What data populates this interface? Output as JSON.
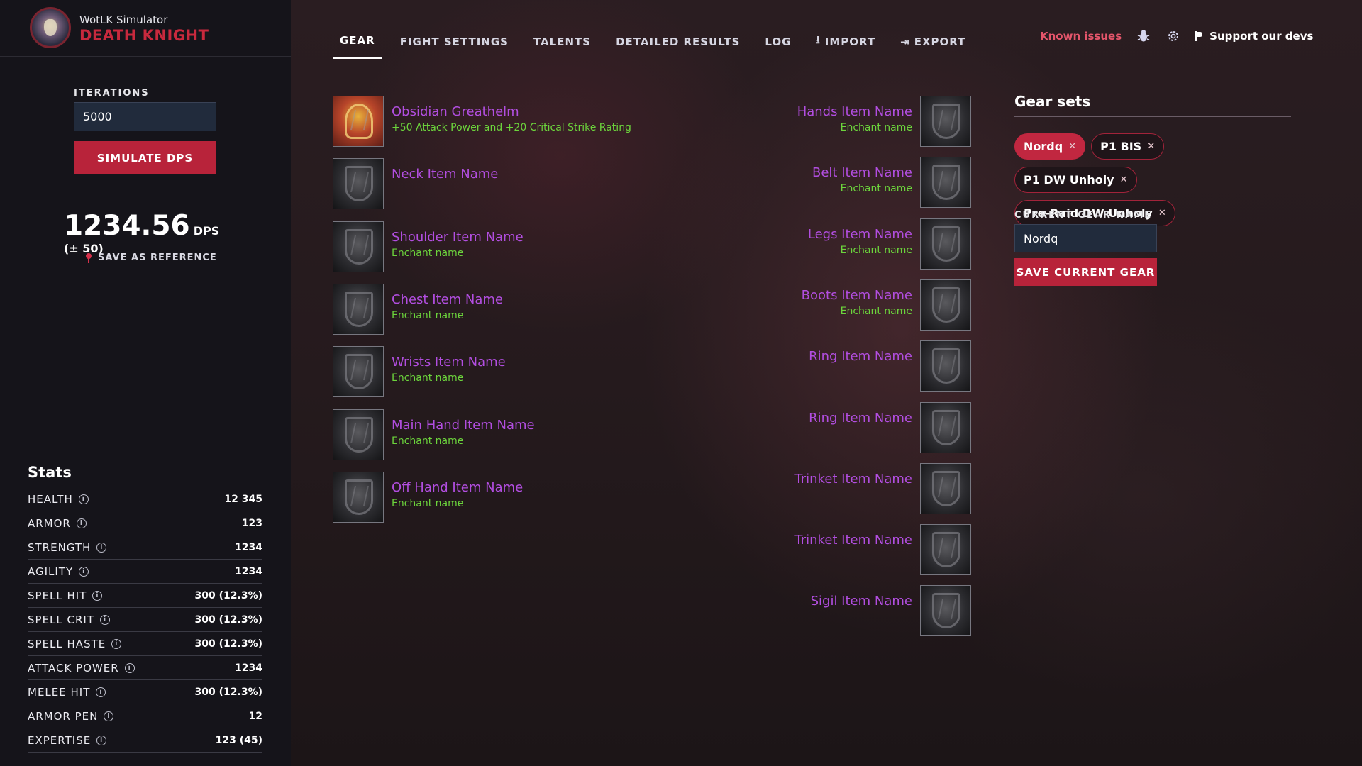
{
  "brand": {
    "subtitle": "WotLK Simulator",
    "title": "DEATH KNIGHT"
  },
  "sidebar": {
    "iterations_label": "ITERATIONS",
    "iterations_value": "5000",
    "simulate_label": "SIMULATE DPS",
    "dps_value": "1234.56",
    "dps_unit": "DPS (± 50)",
    "save_reference_label": "SAVE AS REFERENCE"
  },
  "stats": {
    "title": "Stats",
    "rows": [
      {
        "name": "HEALTH",
        "value": "12 345"
      },
      {
        "name": "ARMOR",
        "value": "123"
      },
      {
        "name": "STRENGTH",
        "value": "1234"
      },
      {
        "name": "AGILITY",
        "value": "1234"
      },
      {
        "name": "SPELL HIT",
        "value": "300 (12.3%)"
      },
      {
        "name": "SPELL CRIT",
        "value": "300 (12.3%)"
      },
      {
        "name": "SPELL HASTE",
        "value": "300 (12.3%)"
      },
      {
        "name": "ATTACK POWER",
        "value": "1234"
      },
      {
        "name": "MELEE HIT",
        "value": "300 (12.3%)"
      },
      {
        "name": "ARMOR PEN",
        "value": "12"
      },
      {
        "name": "EXPERTISE",
        "value": "123 (45)"
      }
    ]
  },
  "nav": {
    "tabs": [
      "GEAR",
      "FIGHT SETTINGS",
      "TALENTS",
      "DETAILED RESULTS",
      "LOG",
      "IMPORT",
      "EXPORT"
    ],
    "active_tab": "GEAR",
    "known_issues": "Known issues",
    "support": "Support our devs"
  },
  "gear": {
    "left": [
      {
        "name": "Obsidian Greathelm",
        "enchant": "+50 Attack Power and +20 Critical Strike Rating",
        "icon": "helm-icon"
      },
      {
        "name": "Neck Item Name",
        "enchant": "",
        "icon": "empty-slot-icon"
      },
      {
        "name": "Shoulder Item Name",
        "enchant": "Enchant name",
        "icon": "empty-slot-icon"
      },
      {
        "name": "Chest Item Name",
        "enchant": "Enchant name",
        "icon": "empty-slot-icon"
      },
      {
        "name": "Wrists Item Name",
        "enchant": "Enchant name",
        "icon": "empty-slot-icon"
      },
      {
        "name": "Main Hand Item Name",
        "enchant": "Enchant name",
        "icon": "empty-slot-icon"
      },
      {
        "name": "Off Hand Item Name",
        "enchant": "Enchant name",
        "icon": "empty-slot-icon"
      }
    ],
    "right": [
      {
        "name": "Hands Item Name",
        "enchant": "Enchant name",
        "icon": "empty-slot-icon"
      },
      {
        "name": "Belt Item Name",
        "enchant": "Enchant name",
        "icon": "empty-slot-icon"
      },
      {
        "name": "Legs Item Name",
        "enchant": "Enchant name",
        "icon": "empty-slot-icon"
      },
      {
        "name": "Boots Item Name",
        "enchant": "Enchant name",
        "icon": "empty-slot-icon"
      },
      {
        "name": "Ring Item Name",
        "enchant": "",
        "icon": "empty-slot-icon"
      },
      {
        "name": "Ring Item Name",
        "enchant": "",
        "icon": "empty-slot-icon"
      },
      {
        "name": "Trinket Item Name",
        "enchant": "",
        "icon": "empty-slot-icon"
      },
      {
        "name": "Trinket Item Name",
        "enchant": "",
        "icon": "empty-slot-icon"
      },
      {
        "name": "Sigil Item Name",
        "enchant": "",
        "icon": "empty-slot-icon"
      }
    ]
  },
  "gear_sets": {
    "title": "Gear sets",
    "sets": [
      {
        "name": "Nordq",
        "active": true
      },
      {
        "name": "P1 BIS",
        "active": false
      },
      {
        "name": "P1 DW Unholy",
        "active": false
      },
      {
        "name": "Pre-Raid DW Unholy",
        "active": false
      }
    ],
    "current_label": "CURRENT GEAR NAME",
    "current_value": "Nordq",
    "save_label": "SAVE CURRENT GEAR"
  },
  "colors": {
    "accent": "#b8233a",
    "item_name": "#b24ee0",
    "enchant": "#6cd43c",
    "known_issues": "#e4556b"
  }
}
